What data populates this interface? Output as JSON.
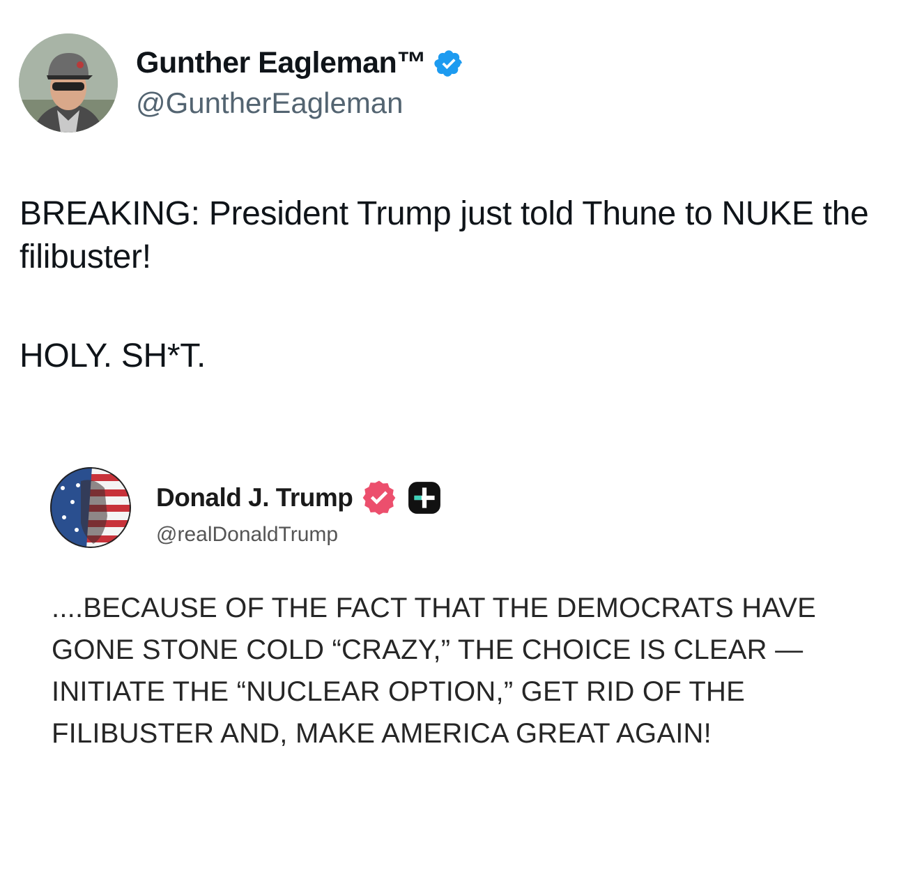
{
  "author": {
    "name": "Gunther Eagleman™",
    "handle": "@GuntherEagleman",
    "verified_color": "#1d9bf0"
  },
  "tweet": {
    "line1": "BREAKING: President Trump just told Thune to NUKE the filibuster!",
    "line2": "HOLY. SH*T."
  },
  "embedded_post": {
    "name": "Donald J. Trump",
    "handle": "@realDonaldTrump",
    "badge_color": "#ec4f6d",
    "text": "....BECAUSE OF THE FACT THAT THE DEMOCRATS HAVE GONE STONE COLD “CRAZY,” THE CHOICE IS CLEAR — INITIATE THE “NUCLEAR OPTION,” GET RID OF THE FILIBUSTER AND, MAKE AMERICA GREAT AGAIN!"
  }
}
